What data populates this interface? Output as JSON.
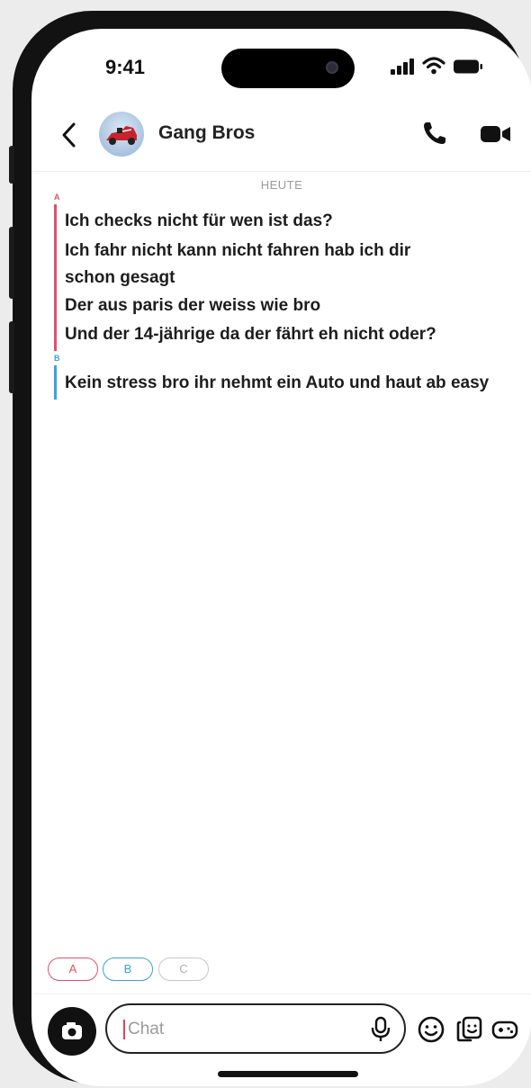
{
  "status_bar": {
    "time": "9:41"
  },
  "header": {
    "title": "Gang Bros"
  },
  "chat": {
    "date_label": "HEUTE",
    "groups": [
      {
        "sender": "A",
        "color": "#e0506a",
        "messages": [
          "Ich checks nicht für wen ist das?",
          "Ich fahr nicht kann nicht fahren hab ich dir",
          "schon gesagt",
          "Der aus paris der weiss wie bro",
          "Und der 14-jährige da der fährt eh nicht oder?"
        ]
      },
      {
        "sender": "B",
        "color": "#3aa3d8",
        "messages": [
          "Kein stress bro ihr nehmt ein Auto und haut ab easy"
        ]
      }
    ]
  },
  "chips": [
    {
      "label": "A",
      "color": "#e0506a"
    },
    {
      "label": "B",
      "color": "#3aa3d8"
    },
    {
      "label": "C",
      "color": "#c8c8c8"
    }
  ],
  "composer": {
    "placeholder": "Chat"
  },
  "icons": {
    "back": "chevron-left-icon",
    "call": "phone-icon",
    "video": "video-camera-icon",
    "camera": "camera-icon",
    "mic": "microphone-icon",
    "emoji": "smiley-icon",
    "stickers": "sticker-icon",
    "games": "gamepad-icon"
  }
}
